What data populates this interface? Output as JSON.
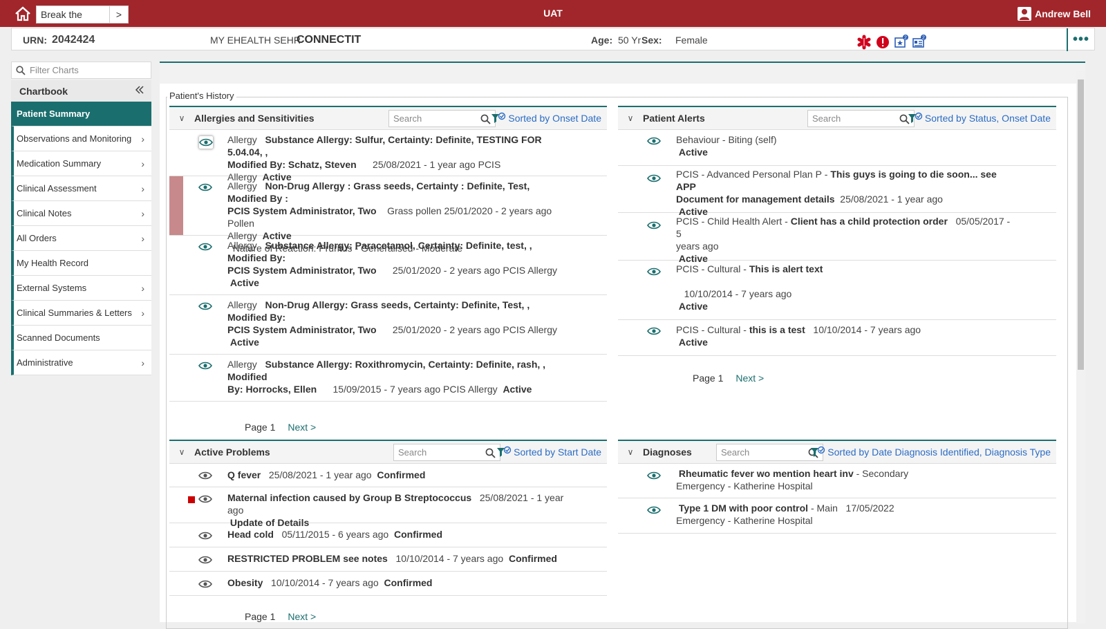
{
  "topbar": {
    "break_glass": "Break the Glass",
    "env": "UAT",
    "user": "Andrew Bell"
  },
  "patient": {
    "urn_label": "URN:",
    "urn": "2042424",
    "source_prefix": "MY EHEALTH SEHR",
    "source": "CONNECTIT",
    "age_label": "Age:",
    "age": "50 Yr",
    "sex_label": "Sex:",
    "sex": "Female",
    "badge1": "2",
    "badge2": "2",
    "more": "•••"
  },
  "sidebar": {
    "filter_placeholder": "Filter Charts",
    "chartbook": "Chartbook",
    "items": [
      {
        "label": "Patient Summary"
      },
      {
        "label": "Observations and Monitoring"
      },
      {
        "label": "Medication Summary"
      },
      {
        "label": "Clinical Assessment"
      },
      {
        "label": "Clinical Notes"
      },
      {
        "label": "All Orders"
      },
      {
        "label": "My Health Record"
      },
      {
        "label": "External Systems"
      },
      {
        "label": "Clinical Summaries & Letters"
      },
      {
        "label": "Scanned Documents"
      },
      {
        "label": "Administrative"
      }
    ]
  },
  "main": {
    "legend": "Patient's History"
  },
  "allergies": {
    "title": "Allergies and Sensitivities",
    "search": "Search",
    "sort": "Sorted by Onset Date",
    "rows": [
      {
        "l1a": "Allergy",
        "l1b": "Substance Allergy: Sulfur, Certainty: Definite, TESTING FOR 5.04.04, ,",
        "l2a": "Modified By: Schatz, Steven",
        "l2b": "25/08/2021 - 1 year ago  PCIS Allergy",
        "l2c": "Active"
      },
      {
        "l1a": "Allergy",
        "l1b": "Non-Drug Allergy : Grass seeds, Certainty : Definite, Test, Modified By :",
        "l2a": "PCIS System Administrator, Two",
        "l2b": "Grass pollen  25/01/2020 - 2 years ago   Pollen",
        "l3a": "Allergy",
        "l3b": "Active",
        "l4": "Nature of Reaction:  Pruritus - Generalised - Moderate"
      },
      {
        "l1a": "Allergy",
        "l1b": "Substance Allergy: Paracetamol, Certainty: Definite, test, , Modified By:",
        "l2a": "PCIS System Administrator, Two",
        "l2b": "25/01/2020 - 2 years ago  PCIS Allergy",
        "l3": "Active"
      },
      {
        "l1a": "Allergy",
        "l1b": "Non-Drug Allergy: Grass seeds, Certainty: Definite, Test, , Modified By:",
        "l2a": "PCIS System Administrator, Two",
        "l2b": "25/01/2020 - 2 years ago  PCIS Allergy",
        "l3": "Active"
      },
      {
        "l1a": "Allergy",
        "l1b": "Substance Allergy: Roxithromycin, Certainty: Definite, rash, , Modified",
        "l2a": "By: Horrocks, Ellen",
        "l2b": "15/09/2015 - 7 years ago  PCIS Allergy",
        "l2c": "Active"
      }
    ],
    "page_label": "Page  1",
    "next": "Next >"
  },
  "alerts": {
    "title": "Patient Alerts",
    "search": "Search",
    "sort": "Sorted by Status, Onset Date",
    "rows": [
      {
        "a": "Behaviour",
        "b": " - Biting (self)",
        "status": "Active"
      },
      {
        "a": "PCIS",
        "b": " - Advanced Personal Plan P",
        "c": "This guys is going to die soon... see APP",
        "d": "Document for management details",
        "e": "25/08/2021 - 1 year ago",
        "status": "Active"
      },
      {
        "a": "PCIS",
        "b": " - Child Health Alert",
        "c": "Client has a child protection order",
        "e": "05/05/2017 - 5",
        "f": "years ago",
        "status": "Active"
      },
      {
        "a": "PCIS",
        "b": " - Cultural",
        "c": "This is alert text",
        "e": "10/10/2014 - 7 years ago",
        "status": "Active"
      },
      {
        "a": "PCIS",
        "b": " - Cultural",
        "c": "this is a test",
        "e": "10/10/2014 - 7 years ago",
        "status": "Active"
      }
    ],
    "page_label": "Page  1",
    "next": "Next >"
  },
  "problems": {
    "title": "Active Problems",
    "search": "Search",
    "sort": "Sorted by Start Date",
    "rows": [
      {
        "name": "Q fever",
        "date": "25/08/2021 - 1 year ago",
        "status": "Confirmed"
      },
      {
        "name": "Maternal infection caused by Group B Streptococcus",
        "date": "25/08/2021 - 1 year ago",
        "status": "Update of Details"
      },
      {
        "name": "Head cold",
        "date": "05/11/2015 - 6 years ago",
        "status": "Confirmed"
      },
      {
        "name": "RESTRICTED PROBLEM see notes",
        "date": "10/10/2014 - 7 years ago",
        "status": "Confirmed"
      },
      {
        "name": "Obesity",
        "date": "10/10/2014 - 7 years ago",
        "status": "Confirmed"
      }
    ],
    "page_label": "Page  1",
    "next": "Next >"
  },
  "diagnoses": {
    "title": "Diagnoses",
    "search": "Search",
    "sort": "Sorted by Date Diagnosis Identified, Diagnosis Type",
    "rows": [
      {
        "name": "Rheumatic fever wo mention heart inv",
        "type": " - Secondary",
        "date": "",
        "loc": "Emergency  - Katherine Hospital"
      },
      {
        "name": "Type 1 DM with poor control",
        "type": " - Main",
        "date": "17/05/2022",
        "loc": "Emergency  - Katherine Hospital"
      }
    ]
  },
  "colors": {
    "brand_red": "#a1262b",
    "teal": "#1b6e6e",
    "link": "#2b6cc4"
  }
}
